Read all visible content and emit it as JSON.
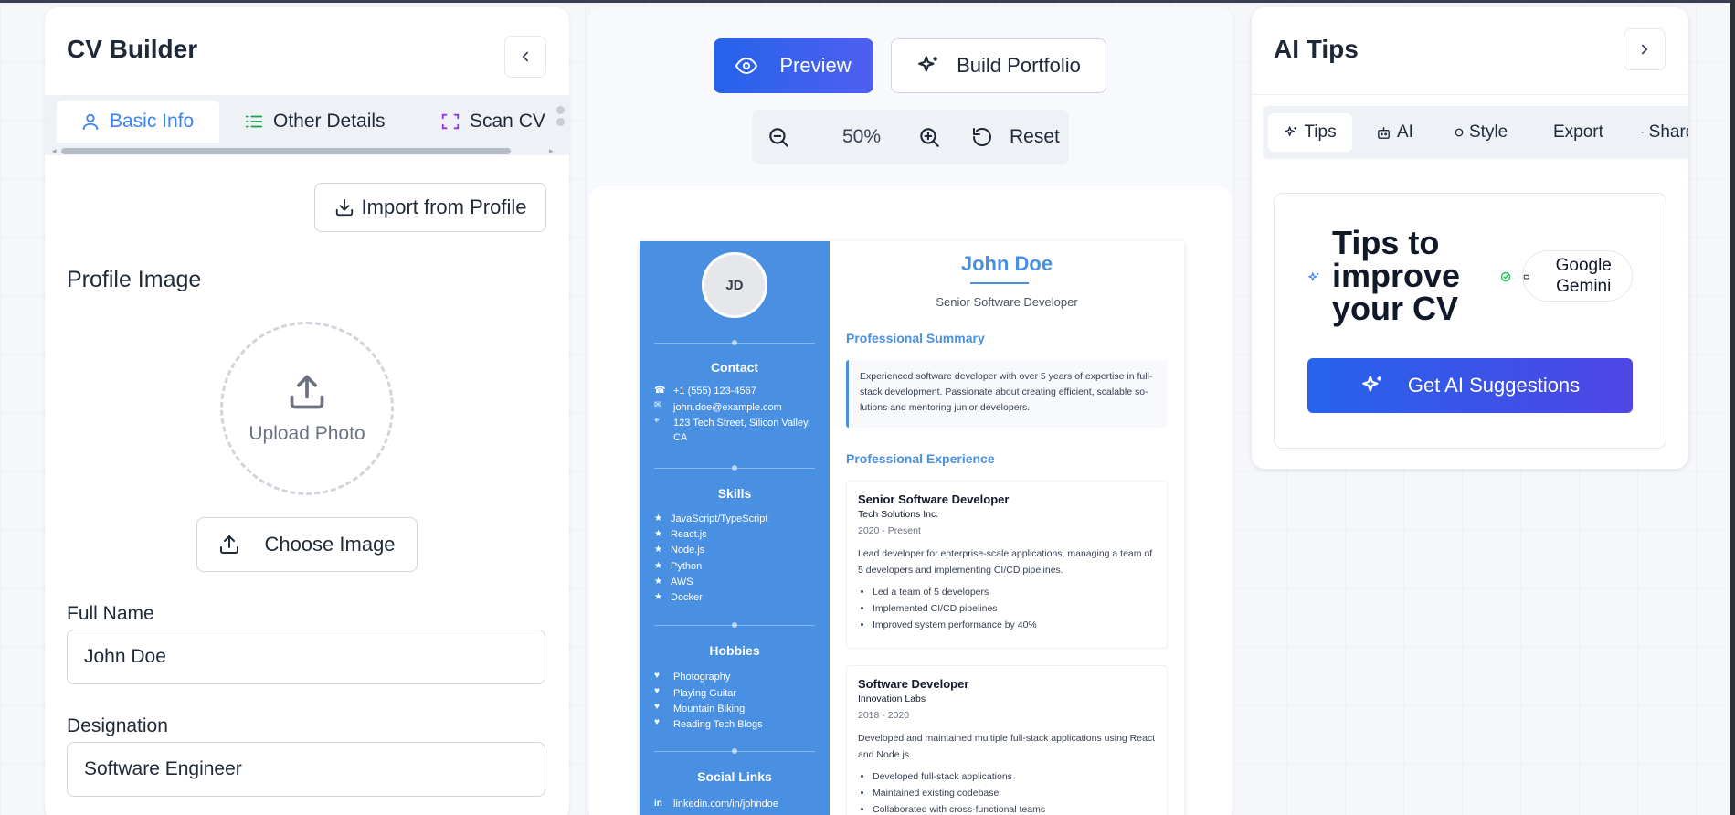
{
  "left_panel": {
    "title": "CV Builder",
    "tabs": [
      {
        "label": "Basic Info",
        "icon": "user-icon",
        "active": true
      },
      {
        "label": "Other Details",
        "icon": "list-icon",
        "active": false
      },
      {
        "label": "Scan CV",
        "icon": "scan-icon",
        "active": false
      }
    ],
    "import_button": "Import from Profile",
    "profile_image_label": "Profile Image",
    "upload_text": "Upload Photo",
    "choose_image_button": "Choose Image",
    "full_name_label": "Full Name",
    "full_name_value": "John Doe",
    "designation_label": "Designation",
    "designation_value": "Software Engineer"
  },
  "toolbar": {
    "preview_label": "Preview",
    "build_portfolio_label": "Build Portfolio",
    "zoom_value": "50%",
    "reset_label": "Reset"
  },
  "cv": {
    "initials": "JD",
    "name": "John Doe",
    "title": "Senior Software Developer",
    "contact_heading": "Contact",
    "phone": "+1 (555) 123-4567",
    "email": "john.doe@example.com",
    "address": "123 Tech Street, Silicon Valley, CA",
    "skills_heading": "Skills",
    "skills": [
      "JavaScript/TypeScript",
      "React.js",
      "Node.js",
      "Python",
      "AWS",
      "Docker"
    ],
    "hobbies_heading": "Hobbies",
    "hobbies": [
      "Photography",
      "Playing Guitar",
      "Mountain Biking",
      "Reading Tech Blogs"
    ],
    "social_heading": "Social Links",
    "linkedin": "linkedin.com/in/johndoe",
    "summary_heading": "Professional Summary",
    "summary": "Experienced software developer with over 5 years of expertise in full-stack development. Passionate about creating efficient, scalable so-lutions and mentoring junior developers.",
    "experience_heading": "Professional Experience",
    "jobs": [
      {
        "title": "Senior Software Developer",
        "company": "Tech Solutions Inc.",
        "dates": "2020 - Present",
        "description": "Lead developer for enterprise-scale applications, managing a team of 5 developers and implementing CI/CD pipelines.",
        "bullets": [
          "Led a team of 5 developers",
          "Implemented CI/CD pipelines",
          "Improved system performance by 40%"
        ]
      },
      {
        "title": "Software Developer",
        "company": "Innovation Labs",
        "dates": "2018 - 2020",
        "description": "Developed and maintained multiple full-stack applications using React and Node.js.",
        "bullets": [
          "Developed full-stack applications",
          "Maintained existing codebase",
          "Collaborated with cross-functional teams"
        ]
      }
    ]
  },
  "right_panel": {
    "title": "AI Tips",
    "tabs": [
      {
        "label": "Tips",
        "active": true
      },
      {
        "label": "AI",
        "active": false
      },
      {
        "label": "Style",
        "active": false
      },
      {
        "label": "Export",
        "active": false
      },
      {
        "label": "Share",
        "active": false
      }
    ],
    "tips_heading": "Tips to improve your CV",
    "provider": "Google Gemini",
    "ai_button": "Get AI Suggestions"
  },
  "colors": {
    "accent": "#3b82f6",
    "cv_blue": "#4a90e2",
    "button_gradient_start": "#2563eb",
    "button_gradient_end": "#4f46e5"
  }
}
